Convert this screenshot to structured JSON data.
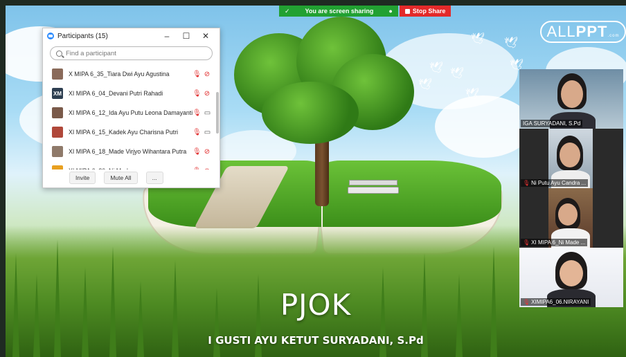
{
  "share_bar": {
    "sharing_text": "You are screen sharing",
    "stop_label": "Stop Share"
  },
  "participants_panel": {
    "title": "Participants (15)",
    "search_placeholder": "Find a participant",
    "participants": [
      {
        "name": "X MIPA 6_35_Tiara Dwi Ayu Agustina",
        "initials": "",
        "avatar_color": "#8a6a5a",
        "muted": true,
        "video_on": false
      },
      {
        "name": "XI MIPA 6_04_Devani Putri Rahadi",
        "initials": "XM",
        "avatar_color": "#2d3e50",
        "muted": true,
        "video_on": false
      },
      {
        "name": "XI MIPA 6_12_Ida Ayu Putu Leona Damayanti",
        "initials": "",
        "avatar_color": "#7a5a4a",
        "muted": true,
        "video_on": true
      },
      {
        "name": "XI MIPA 6_15_Kadek Ayu Charisna Putri",
        "initials": "",
        "avatar_color": "#b0483a",
        "muted": true,
        "video_on": true
      },
      {
        "name": "XI MIPA 6_18_Made Virjyo Wihantara Putra",
        "initials": "",
        "avatar_color": "#8f7a6a",
        "muted": true,
        "video_on": false
      },
      {
        "name": "XI MIPA 6_20_Ni Made ...",
        "initials": "",
        "avatar_color": "#e8a020",
        "muted": true,
        "video_on": false
      }
    ],
    "footer": {
      "invite_label": "Invite",
      "mute_all_label": "Mute All",
      "more_label": "..."
    }
  },
  "slide": {
    "title": "PJOK",
    "presenter": "I GUSTI AYU KETUT SURYADANI, S.Pd",
    "logo_text_light": "ALL",
    "logo_text_bold": "PPT",
    "logo_text_small": ".com"
  },
  "videos": [
    {
      "label": "IGA SURYADANI, S.Pd",
      "muted": false
    },
    {
      "label": "Ni Putu Ayu Candra ...",
      "muted": true
    },
    {
      "label": "XI MIPA 6_Ni Made ...",
      "muted": true
    },
    {
      "label": "XIMIPA6_06.NIRAYANI",
      "muted": true
    }
  ]
}
